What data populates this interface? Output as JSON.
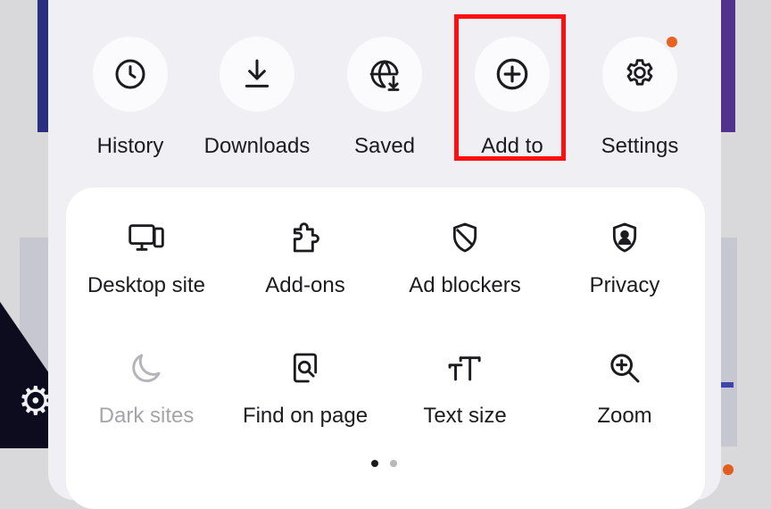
{
  "quick_actions": [
    {
      "label": "History",
      "icon": "clock-icon"
    },
    {
      "label": "Downloads",
      "icon": "download-icon"
    },
    {
      "label": "Saved",
      "icon": "globe-download-icon"
    },
    {
      "label": "Add to",
      "icon": "plus-circle-icon",
      "highlighted": true
    },
    {
      "label": "Settings",
      "icon": "gear-icon",
      "has_notification": true
    }
  ],
  "menu": {
    "page": 1,
    "page_count": 2,
    "items": [
      {
        "label": "Desktop site",
        "icon": "desktop-icon"
      },
      {
        "label": "Add-ons",
        "icon": "puzzle-icon"
      },
      {
        "label": "Ad blockers",
        "icon": "shield-block-icon"
      },
      {
        "label": "Privacy",
        "icon": "privacy-shield-icon"
      },
      {
        "label": "Dark sites",
        "icon": "moon-icon",
        "disabled": true
      },
      {
        "label": "Find on page",
        "icon": "find-page-icon"
      },
      {
        "label": "Text size",
        "icon": "text-size-icon"
      },
      {
        "label": "Zoom",
        "icon": "zoom-in-icon"
      }
    ]
  },
  "colors": {
    "highlight": "#ff1010",
    "notification": "#e8631f",
    "text": "#1c1b1f",
    "disabled_text": "#a5a4ab"
  }
}
